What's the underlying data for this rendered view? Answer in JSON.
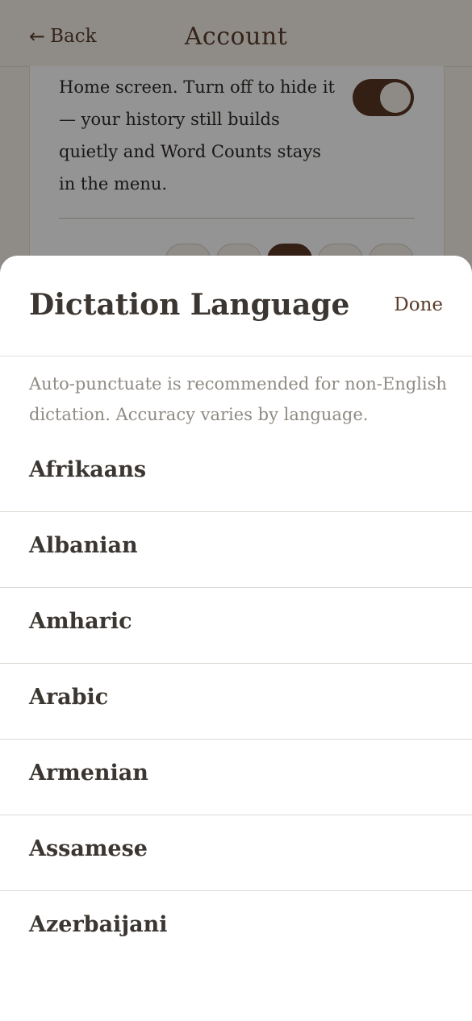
{
  "background": {
    "back_label": "Back",
    "back_icon": "left-arrow-icon",
    "title": "Account",
    "card_text": "Home screen. Turn off to hide it — your history still builds quietly and Word Counts stays in the menu.",
    "toggle_on": true,
    "segments_selected_index": 2
  },
  "sheet": {
    "title": "Dictation Language",
    "done_label": "Done",
    "hint": "Auto-punctuate is recommended for non-English dictation. Accuracy varies by language.",
    "languages": [
      "Afrikaans",
      "Albanian",
      "Amharic",
      "Arabic",
      "Armenian",
      "Assamese",
      "Azerbaijani"
    ]
  },
  "colors": {
    "accent": "#5a3623",
    "text_primary": "#3b3631",
    "text_muted": "#8f8a84"
  }
}
